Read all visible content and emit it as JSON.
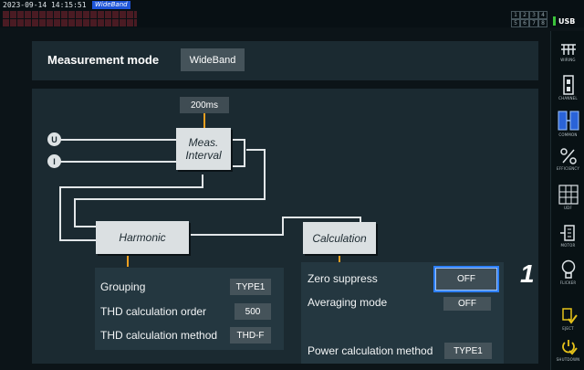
{
  "status": {
    "datetime": "2023-09-14 14:15:51",
    "mode_badge": "WideBand",
    "channels_row1": [
      "1",
      "2",
      "3",
      "4"
    ],
    "channels_row2": [
      "5",
      "6",
      "7",
      "8"
    ],
    "usb": "USB"
  },
  "header": {
    "title": "Measurement mode",
    "mode_value": "WideBand"
  },
  "diagram": {
    "interval_value": "200ms",
    "input_u": "U",
    "input_i": "I",
    "meas_interval_line1": "Meas.",
    "meas_interval_line2": "Interval",
    "harmonic": "Harmonic",
    "calculation": "Calculation"
  },
  "harmonic_settings": {
    "grouping_label": "Grouping",
    "grouping_value": "TYPE1",
    "thd_order_label": "THD calculation order",
    "thd_order_value": "500",
    "thd_method_label": "THD calculation method",
    "thd_method_value": "THD-F"
  },
  "calculation_settings": {
    "zero_suppress_label": "Zero suppress",
    "zero_suppress_value": "OFF",
    "averaging_label": "Averaging mode",
    "averaging_value": "OFF",
    "power_method_label": "Power calculation method",
    "power_method_value": "TYPE1"
  },
  "callout": "1",
  "sidebar": {
    "items": [
      {
        "label": "WIRING",
        "icon": "wiring-icon"
      },
      {
        "label": "CHANNEL",
        "icon": "channel-icon"
      },
      {
        "label": "COMMON",
        "icon": "common-icon"
      },
      {
        "label": "EFFICIENCY",
        "icon": "efficiency-icon"
      },
      {
        "label": "UDF",
        "icon": "udf-icon"
      },
      {
        "label": "MOTOR",
        "icon": "motor-icon"
      },
      {
        "label": "FLICKER",
        "icon": "flicker-icon"
      },
      {
        "label": "EJECT",
        "icon": "eject-icon"
      },
      {
        "label": "SHUTDOWN",
        "icon": "shutdown-icon"
      }
    ]
  },
  "colors": {
    "accent_orange": "#f0a020",
    "selected_blue": "#2d7ff9",
    "active_blue": "#2a63d8",
    "eject_yellow": "#e6c21a"
  }
}
